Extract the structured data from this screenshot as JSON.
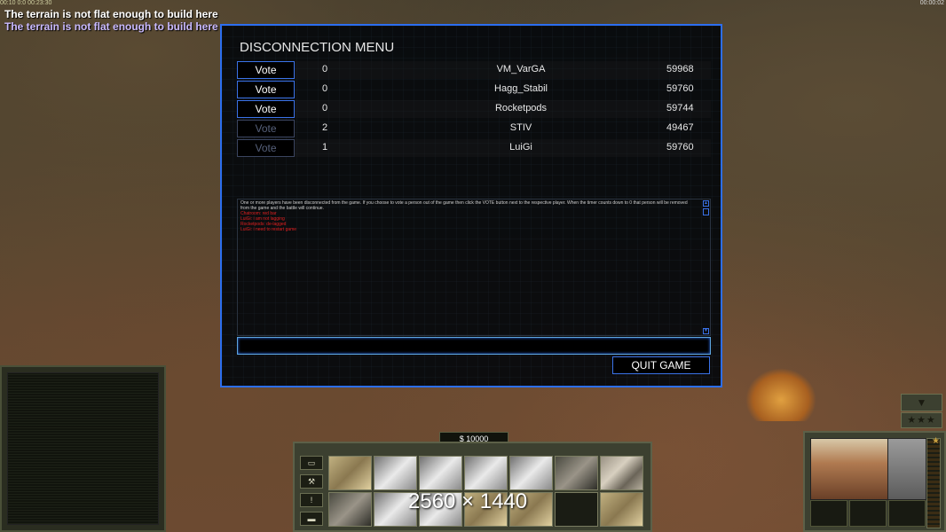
{
  "hud": {
    "top_left": "00:10 0:0 00:23:30",
    "top_right": "00:00:02",
    "warning_lines": [
      "The terrain is not flat enough to build here",
      "The terrain is not flat enough to build here"
    ]
  },
  "dialog": {
    "title": "DISCONNECTION MENU",
    "players": [
      {
        "vote_label": "Vote",
        "votes": "0",
        "name": "VM_VarGA",
        "ping": "59968",
        "enabled": true
      },
      {
        "vote_label": "Vote",
        "votes": "0",
        "name": "Hagg_Stabil",
        "ping": "59760",
        "enabled": true
      },
      {
        "vote_label": "Vote",
        "votes": "0",
        "name": "Rocketpods",
        "ping": "59744",
        "enabled": true
      },
      {
        "vote_label": "Vote",
        "votes": "2",
        "name": "STIV",
        "ping": "49467",
        "enabled": false
      },
      {
        "vote_label": "Vote",
        "votes": "1",
        "name": "LuiGi",
        "ping": "59760",
        "enabled": false
      }
    ],
    "log": {
      "info": "One or more players have been disconnected from the game. If you choose to vote a person out of the game then click the VOTE button next to the respective player. When the timer counts down to 0 that person will be removed from the game and the battle will continue.",
      "messages": [
        "Chatroom: red bar",
        "LuiGi: i am not lagging",
        "Rocketpods: de-lagged",
        "LuiGi: i need to restart game"
      ],
      "message_color": "#e02020"
    },
    "chat_input_value": "",
    "quit_label": "QUIT GAME",
    "accent_color": "#2c6ef0"
  },
  "command_bar": {
    "money": "$ 10000",
    "side_buttons": [
      "▭",
      "⚒",
      "!",
      "▬"
    ],
    "watermark": "2560 × 1440"
  },
  "rank": {
    "arrow": "▼",
    "stars": "★★★"
  },
  "portrait": {
    "star": "★"
  }
}
